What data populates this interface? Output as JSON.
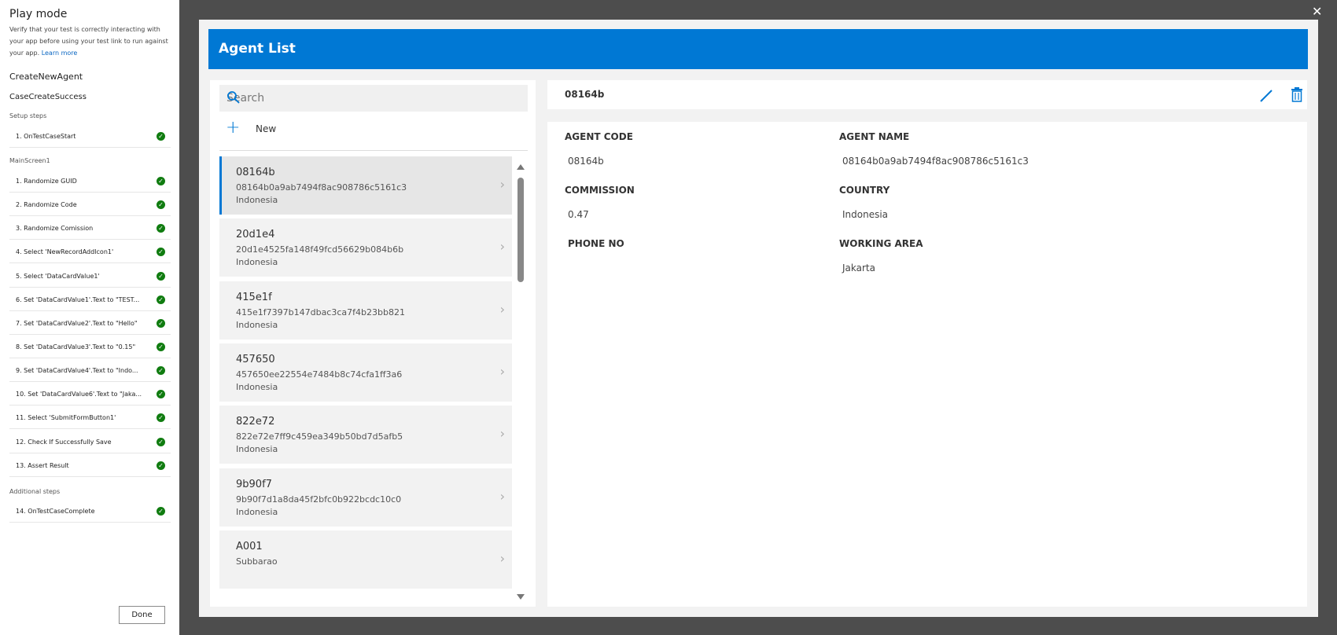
{
  "test_pane": {
    "title": "Play mode",
    "description": "Verify that your test is correctly interacting with your app before using your test link to run against your app.",
    "learn_more": "Learn more",
    "test_case_group": "CreateNewAgent",
    "test_case": "CaseCreateSuccess",
    "setup_label": "Setup steps",
    "setup_steps": [
      "1. OnTestCaseStart"
    ],
    "screen_label": "MainScreen1",
    "steps": [
      "1. Randomize GUID",
      "2. Randomize Code",
      "3. Randomize Comission",
      "4. Select 'NewRecordAddIcon1'",
      "5. Select 'DataCardValue1'",
      "6. Set 'DataCardValue1'.Text to \"TEST...",
      "7. Set 'DataCardValue2'.Text to \"Hello\"",
      "8. Set 'DataCardValue3'.Text to \"0.15\"",
      "9. Set 'DataCardValue4'.Text to \"Indo...",
      "10. Set 'DataCardValue6'.Text to \"Jaka...",
      "11. Select 'SubmitFormButton1'",
      "12. Check If Successfully Save",
      "13. Assert Result"
    ],
    "additional_label": "Additional steps",
    "additional_steps": [
      "14. OnTestCaseComplete"
    ],
    "done_label": "Done",
    "step_status_color": "#107c10"
  },
  "app": {
    "header_title": "Agent List",
    "header_color": "#0078d4",
    "search_placeholder": "Search",
    "new_label": "New",
    "agents": [
      {
        "code": "08164b",
        "id": "08164b0a9ab7494f8ac908786c5161c3",
        "country": "Indonesia"
      },
      {
        "code": "20d1e4",
        "id": "20d1e4525fa148f49fcd56629b084b6b",
        "country": "Indonesia"
      },
      {
        "code": "415e1f",
        "id": "415e1f7397b147dbac3ca7f4b23bb821",
        "country": "Indonesia"
      },
      {
        "code": "457650",
        "id": "457650ee22554e7484b8c74cfa1ff3a6",
        "country": "Indonesia"
      },
      {
        "code": "822e72",
        "id": "822e72e7ff9c459ea349b50bd7d5afb5",
        "country": "Indonesia"
      },
      {
        "code": "9b90f7",
        "id": "9b90f7d1a8da45f2bfc0b922bcdc10c0",
        "country": "Indonesia"
      },
      {
        "code": "A001",
        "id": "Subbarao",
        "country": ""
      }
    ],
    "detail": {
      "header_code": "08164b",
      "fields": {
        "agent_code_label": "AGENT CODE",
        "agent_code_value": "08164b",
        "agent_name_label": "AGENT NAME",
        "agent_name_value": "08164b0a9ab7494f8ac908786c5161c3",
        "commission_label": "COMMISSION",
        "commission_value": "0.47",
        "country_label": "COUNTRY",
        "country_value": "Indonesia",
        "phone_label": "PHONE NO",
        "phone_value": "",
        "working_area_label": "WORKING AREA",
        "working_area_value": "Jakarta"
      }
    }
  },
  "icons": {
    "close": "close-icon",
    "search": "search-icon",
    "add": "plus-icon",
    "edit": "pencil-icon",
    "delete": "trash-icon",
    "check": "checkmark-icon",
    "chevron": "chevron-right-icon"
  }
}
